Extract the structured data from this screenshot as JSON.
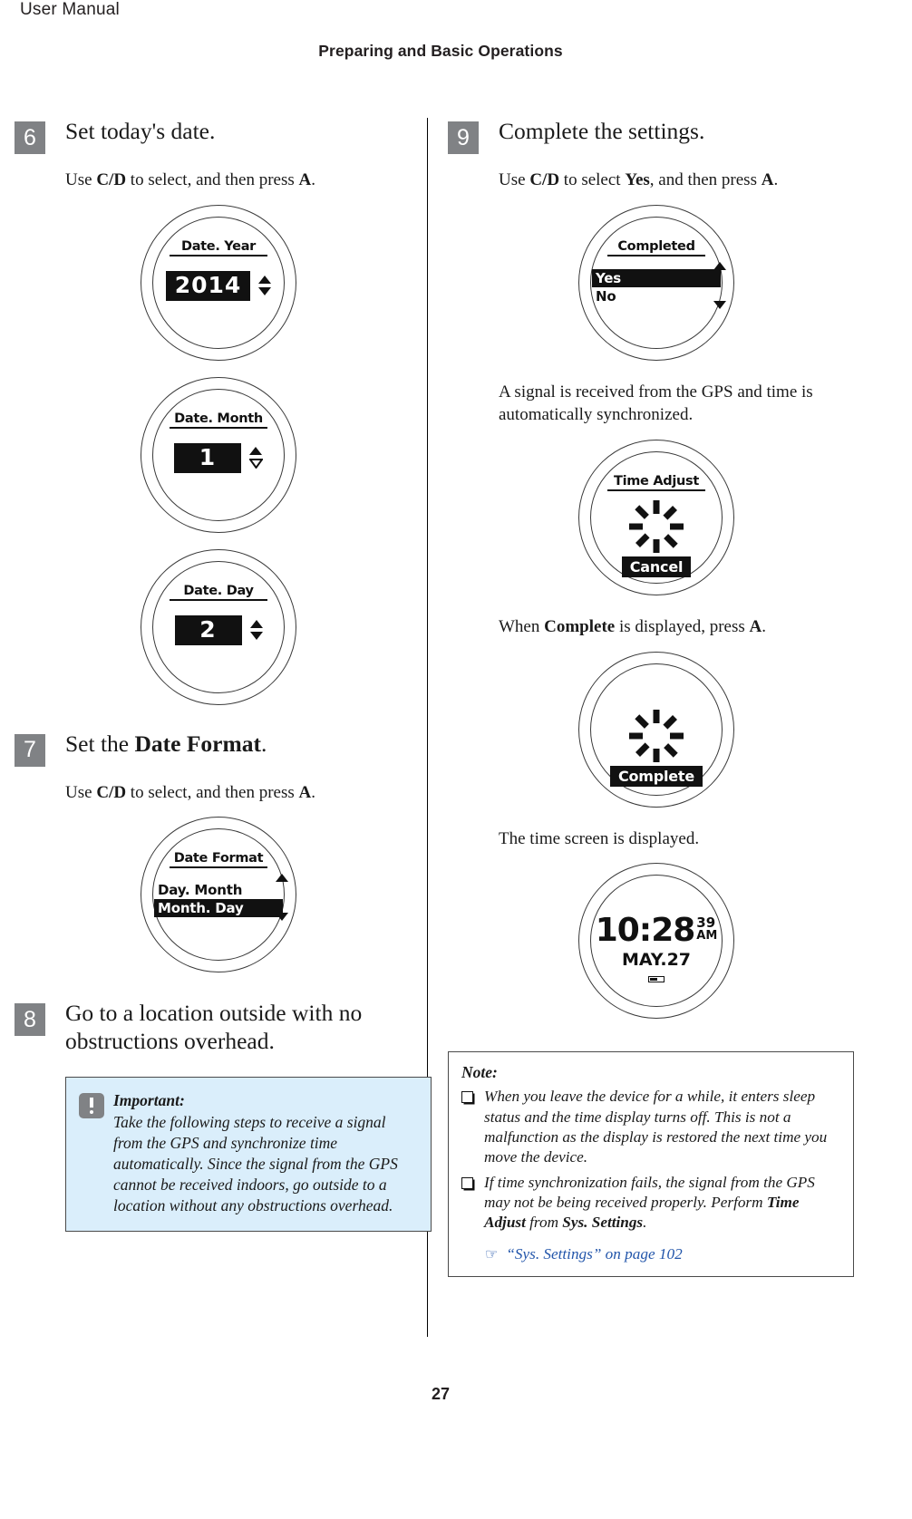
{
  "header": {
    "manual_label": "User Manual",
    "chapter": "Preparing and Basic Operations"
  },
  "footer": {
    "page_number": "27"
  },
  "left_column": {
    "step6": {
      "number": "6",
      "title": "Set today's date.",
      "instruction_pre": "Use ",
      "instruction_key1": "C/D",
      "instruction_mid": " to select, and then press ",
      "instruction_key2": "A",
      "instruction_end": ".",
      "screens": [
        {
          "title": "Date. Year",
          "value": "2014",
          "arrow_up": "up-triangle",
          "arrow_down": "down-triangle-solid"
        },
        {
          "title": "Date. Month",
          "value": "1",
          "arrow_up": "up-triangle",
          "arrow_down": "down-triangle-hollow"
        },
        {
          "title": "Date. Day",
          "value": "2",
          "arrow_up": "up-triangle",
          "arrow_down": "down-triangle-solid"
        }
      ]
    },
    "step7": {
      "number": "7",
      "title_pre": "Set the ",
      "title_bold": "Date Format",
      "title_end": ".",
      "instruction_pre": "Use ",
      "instruction_key1": "C/D",
      "instruction_mid": " to select, and then press ",
      "instruction_key2": "A",
      "instruction_end": ".",
      "screen": {
        "title": "Date Format",
        "options": [
          {
            "label": "Day. Month",
            "selected": false
          },
          {
            "label": "Month. Day",
            "selected": true
          }
        ]
      }
    },
    "step8": {
      "number": "8",
      "title": "Go to a location outside with no obstructions overhead.",
      "important": {
        "label": "Important:",
        "text": "Take the following steps to receive a signal from the GPS and synchronize time automatically. Since the signal from the GPS cannot be received indoors, go outside to a location without any obstructions overhead.",
        "icon": "exclamation-icon",
        "background_color": "#daeefb"
      }
    }
  },
  "right_column": {
    "step9": {
      "number": "9",
      "title": "Complete the settings.",
      "instruction_pre": "Use ",
      "instruction_key1": "C/D",
      "instruction_mid": " to select ",
      "instruction_key2": "Yes",
      "instruction_mid2": ", and then press ",
      "instruction_key3": "A",
      "instruction_end": ".",
      "screen_completed": {
        "title": "Completed",
        "options": [
          {
            "label": "Yes",
            "selected": true
          },
          {
            "label": "No",
            "selected": false
          }
        ]
      },
      "text_signal": "A signal is received from the GPS and time is automatically synchronized.",
      "screen_time_adjust": {
        "title": "Time Adjust",
        "icon": "sunburst-spinner-icon",
        "button": "Cancel"
      },
      "text_complete_pre": "When ",
      "text_complete_bold": "Complete",
      "text_complete_end": " is displayed, press ",
      "text_complete_key": "A",
      "text_complete_period": ".",
      "screen_complete": {
        "icon": "sunburst-spinner-icon",
        "button": "Complete"
      },
      "text_time_screen": "The time screen is displayed.",
      "screen_time": {
        "time": "10:28",
        "seconds": "39",
        "ampm": "AM",
        "date": "MAY.27",
        "battery_icon": "battery-icon"
      }
    },
    "note": {
      "title": "Note:",
      "items": [
        {
          "pre": "When you leave the device for a while, it enters sleep status and the time display turns off. This is not a malfunction as the display is restored the next time you move the device.",
          "bold1": "",
          "mid": "",
          "bold2": "",
          "end": ""
        },
        {
          "pre": "If time synchronization fails, the signal from the GPS may not be being received properly. Perform ",
          "bold1": "Time Adjust",
          "mid": " from ",
          "bold2": "Sys. Settings",
          "end": "."
        }
      ],
      "link": {
        "icon": "pointing-hand-icon",
        "icon_glyph": "☞",
        "text": "“Sys. Settings” on page 102",
        "color": "#2255aa"
      }
    }
  }
}
